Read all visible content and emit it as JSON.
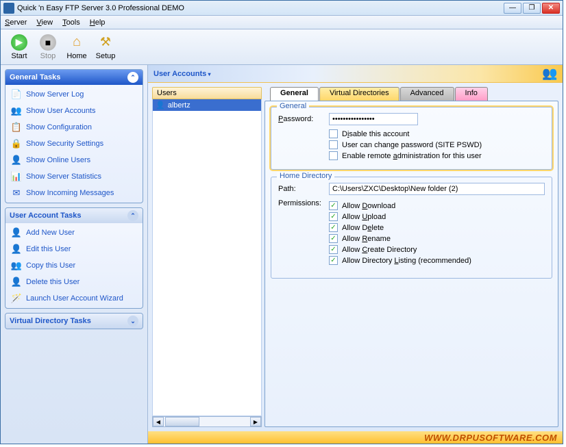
{
  "title": "Quick 'n Easy FTP Server 3.0 Professional DEMO",
  "menu": {
    "server": "Server",
    "view": "View",
    "tools": "Tools",
    "help": "Help"
  },
  "toolbar": {
    "start": "Start",
    "stop": "Stop",
    "home": "Home",
    "setup": "Setup"
  },
  "sidebar": {
    "general": {
      "title": "General Tasks",
      "items": [
        "Show Server Log",
        "Show User Accounts",
        "Show Configuration",
        "Show Security Settings",
        "Show Online Users",
        "Show Server Statistics",
        "Show Incoming Messages"
      ]
    },
    "user": {
      "title": "User Account Tasks",
      "items": [
        "Add New User",
        "Edit this User",
        "Copy this User",
        "Delete this User",
        "Launch User Account Wizard"
      ]
    },
    "vdir": {
      "title": "Virtual Directory Tasks"
    }
  },
  "main": {
    "header": "User Accounts",
    "users_header": "Users",
    "users": [
      "albertz"
    ],
    "tabs": [
      "General",
      "Virtual Directories",
      "Advanced",
      "Info"
    ],
    "general_group": {
      "legend": "General",
      "password_label": "Password:",
      "password_value": "••••••••••••••••",
      "disable_account": "Disable this account",
      "user_change_pw": "User can change password (SITE PSWD)",
      "remote_admin": "Enable remote administration for this user"
    },
    "home_group": {
      "legend": "Home Directory",
      "path_label": "Path:",
      "path_value": "C:\\Users\\ZXC\\Desktop\\New folder (2)",
      "perm_label": "Permissions:",
      "perms": [
        "Allow Download",
        "Allow Upload",
        "Allow Delete",
        "Allow Rename",
        "Allow Create Directory",
        "Allow Directory Listing (recommended)"
      ]
    }
  },
  "footer": "WWW.DRPUSOFTWARE.COM"
}
